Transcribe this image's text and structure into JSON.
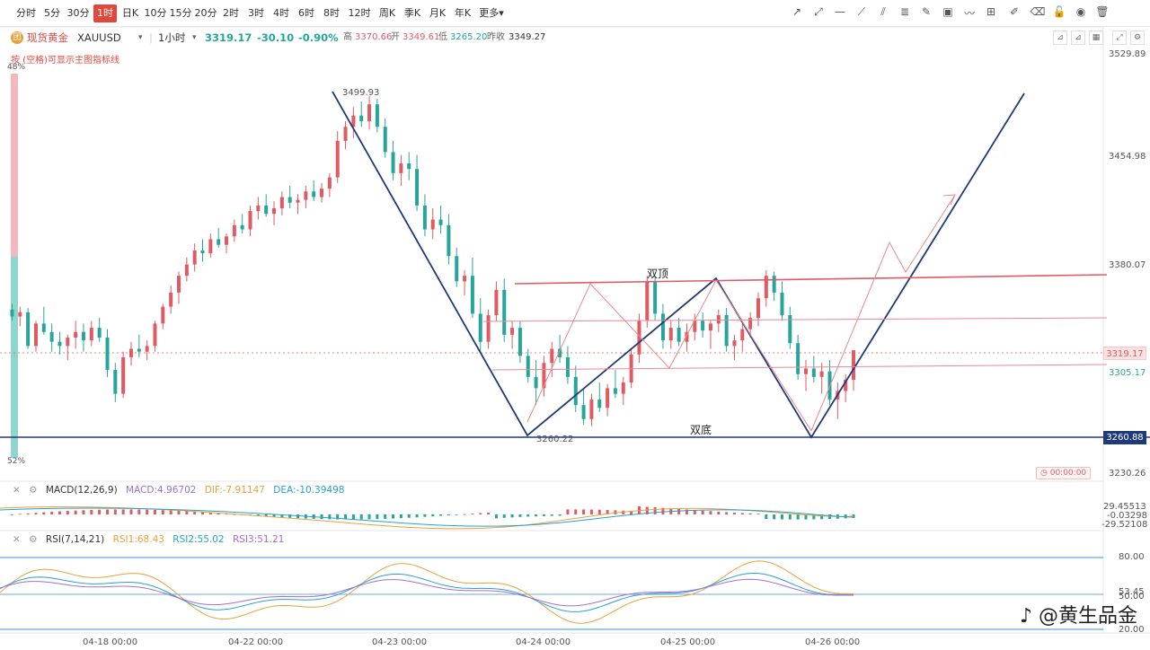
{
  "timeframes": [
    "分时",
    "5分",
    "30分",
    "1时",
    "日K",
    "10分",
    "15分",
    "20分",
    "2时",
    "3时",
    "4时",
    "6时",
    "8时",
    "12时",
    "周K",
    "季K",
    "月K",
    "年K",
    "更多"
  ],
  "active_timeframe": "1时",
  "symbol": {
    "logo_char": "团",
    "name": "现货黄金",
    "code": "XAUUSD",
    "period": "1小时",
    "price": "3319.17",
    "change": "-30.10",
    "change_pct": "-0.90%",
    "high_label": "高",
    "high": "3370.66",
    "open_label": "开",
    "open": "3349.61",
    "low_label": "低",
    "low": "3265.20",
    "prev_close_label": "昨收",
    "prev_close": "3349.27"
  },
  "hint": "按 (空格)可显示主图指标线",
  "pct_top": "48%",
  "pct_bottom": "52%",
  "price_axis": [
    "3529.89",
    "3454.98",
    "3380.07",
    "3305.17",
    "3230.26"
  ],
  "current_price_tag": "3319.17",
  "support_price_tag": "3260.88",
  "countdown": "00:00:00",
  "annotations": {
    "peak_value": "3499.93",
    "trough_value": "3260.22",
    "double_top": "双顶",
    "double_bottom": "双底"
  },
  "macd": {
    "title": "MACD(12,26,9)",
    "macd": "MACD:4.96702",
    "dif": "DIF:-7.91147",
    "dea": "DEA:-10.39498",
    "axis": [
      "29.45513",
      "-0.03298",
      "-29.52108"
    ]
  },
  "rsi": {
    "title": "RSI(7,14,21)",
    "rsi1": "RSI1:68.43",
    "rsi2": "RSI2:55.02",
    "rsi3": "RSI3:51.21",
    "axis": [
      "80.00",
      "53.45",
      "50.00",
      "20.00"
    ]
  },
  "time_axis": [
    "04-18 00:00",
    "04-22 00:00",
    "04-23 00:00",
    "04-24 00:00",
    "04-25 00:00",
    "04-26 00:00"
  ],
  "watermark": "@黄生品金",
  "colors": {
    "up": "#e05a63",
    "down": "#26a69a",
    "accent": "#e0483e",
    "trend": "#1f3a7a"
  },
  "chart_data": {
    "type": "candlestick",
    "symbol": "XAUUSD",
    "interval": "1h",
    "ylim": [
      3230.26,
      3529.89
    ],
    "candles_ohlc": [
      [
        3348,
        3352,
        3340,
        3343
      ],
      [
        3343,
        3350,
        3336,
        3346
      ],
      [
        3346,
        3349,
        3320,
        3322
      ],
      [
        3322,
        3340,
        3318,
        3338
      ],
      [
        3338,
        3350,
        3330,
        3332
      ],
      [
        3332,
        3338,
        3318,
        3325
      ],
      [
        3325,
        3332,
        3316,
        3322
      ],
      [
        3322,
        3330,
        3312,
        3328
      ],
      [
        3328,
        3340,
        3320,
        3332
      ],
      [
        3332,
        3338,
        3318,
        3326
      ],
      [
        3326,
        3340,
        3322,
        3335
      ],
      [
        3335,
        3342,
        3325,
        3328
      ],
      [
        3328,
        3334,
        3300,
        3305
      ],
      [
        3305,
        3310,
        3282,
        3288
      ],
      [
        3288,
        3318,
        3285,
        3314
      ],
      [
        3314,
        3325,
        3308,
        3320
      ],
      [
        3320,
        3330,
        3314,
        3318
      ],
      [
        3318,
        3326,
        3312,
        3322
      ],
      [
        3322,
        3340,
        3318,
        3338
      ],
      [
        3338,
        3352,
        3334,
        3350
      ],
      [
        3350,
        3365,
        3345,
        3360
      ],
      [
        3360,
        3375,
        3352,
        3372
      ],
      [
        3372,
        3385,
        3368,
        3380
      ],
      [
        3380,
        3395,
        3375,
        3390
      ],
      [
        3390,
        3398,
        3382,
        3388
      ],
      [
        3388,
        3402,
        3385,
        3398
      ],
      [
        3398,
        3406,
        3392,
        3394
      ],
      [
        3394,
        3402,
        3388,
        3400
      ],
      [
        3400,
        3412,
        3396,
        3408
      ],
      [
        3408,
        3416,
        3402,
        3405
      ],
      [
        3405,
        3422,
        3400,
        3418
      ],
      [
        3418,
        3428,
        3412,
        3422
      ],
      [
        3422,
        3430,
        3414,
        3416
      ],
      [
        3416,
        3425,
        3408,
        3420
      ],
      [
        3420,
        3432,
        3415,
        3428
      ],
      [
        3428,
        3436,
        3420,
        3424
      ],
      [
        3424,
        3430,
        3416,
        3426
      ],
      [
        3426,
        3436,
        3420,
        3432
      ],
      [
        3432,
        3440,
        3425,
        3428
      ],
      [
        3428,
        3438,
        3424,
        3434
      ],
      [
        3434,
        3445,
        3428,
        3442
      ],
      [
        3442,
        3475,
        3438,
        3468
      ],
      [
        3468,
        3482,
        3462,
        3478
      ],
      [
        3478,
        3492,
        3470,
        3486
      ],
      [
        3486,
        3496,
        3478,
        3482
      ],
      [
        3482,
        3500,
        3476,
        3494
      ],
      [
        3494,
        3498,
        3474,
        3478
      ],
      [
        3478,
        3484,
        3456,
        3460
      ],
      [
        3460,
        3468,
        3440,
        3445
      ],
      [
        3445,
        3458,
        3436,
        3452
      ],
      [
        3452,
        3460,
        3440,
        3448
      ],
      [
        3448,
        3458,
        3418,
        3422
      ],
      [
        3422,
        3430,
        3400,
        3405
      ],
      [
        3405,
        3420,
        3398,
        3412
      ],
      [
        3412,
        3422,
        3402,
        3408
      ],
      [
        3408,
        3416,
        3380,
        3386
      ],
      [
        3386,
        3392,
        3364,
        3368
      ],
      [
        3368,
        3376,
        3358,
        3372
      ],
      [
        3372,
        3385,
        3342,
        3345
      ],
      [
        3345,
        3356,
        3318,
        3325
      ],
      [
        3325,
        3348,
        3320,
        3344
      ],
      [
        3344,
        3368,
        3340,
        3362
      ],
      [
        3362,
        3370,
        3325,
        3330
      ],
      [
        3330,
        3340,
        3320,
        3335
      ],
      [
        3335,
        3340,
        3310,
        3315
      ],
      [
        3315,
        3320,
        3296,
        3300
      ],
      [
        3300,
        3312,
        3280,
        3292
      ],
      [
        3292,
        3315,
        3286,
        3310
      ],
      [
        3310,
        3325,
        3300,
        3320
      ],
      [
        3320,
        3330,
        3310,
        3314
      ],
      [
        3314,
        3322,
        3295,
        3300
      ],
      [
        3300,
        3308,
        3275,
        3280
      ],
      [
        3280,
        3292,
        3266,
        3270
      ],
      [
        3270,
        3288,
        3265,
        3284
      ],
      [
        3284,
        3296,
        3275,
        3278
      ],
      [
        3278,
        3295,
        3272,
        3292
      ],
      [
        3292,
        3305,
        3285,
        3288
      ],
      [
        3288,
        3300,
        3280,
        3296
      ],
      [
        3296,
        3320,
        3292,
        3316
      ],
      [
        3316,
        3345,
        3310,
        3340
      ],
      [
        3340,
        3372,
        3335,
        3368
      ],
      [
        3368,
        3372,
        3340,
        3345
      ],
      [
        3345,
        3352,
        3320,
        3326
      ],
      [
        3326,
        3340,
        3320,
        3335
      ],
      [
        3335,
        3342,
        3322,
        3325
      ],
      [
        3325,
        3338,
        3318,
        3332
      ],
      [
        3332,
        3345,
        3326,
        3340
      ],
      [
        3340,
        3346,
        3328,
        3333
      ],
      [
        3333,
        3340,
        3320,
        3338
      ],
      [
        3338,
        3348,
        3332,
        3344
      ],
      [
        3344,
        3349,
        3318,
        3322
      ],
      [
        3322,
        3330,
        3312,
        3326
      ],
      [
        3326,
        3338,
        3318,
        3334
      ],
      [
        3334,
        3346,
        3328,
        3342
      ],
      [
        3342,
        3360,
        3336,
        3356
      ],
      [
        3356,
        3376,
        3350,
        3372
      ],
      [
        3372,
        3375,
        3354,
        3360
      ],
      [
        3360,
        3368,
        3340,
        3344
      ],
      [
        3344,
        3350,
        3320,
        3324
      ],
      [
        3324,
        3330,
        3298,
        3302
      ],
      [
        3302,
        3312,
        3290,
        3306
      ],
      [
        3306,
        3315,
        3296,
        3300
      ],
      [
        3300,
        3310,
        3288,
        3304
      ],
      [
        3304,
        3312,
        3280,
        3284
      ],
      [
        3284,
        3296,
        3270,
        3290
      ],
      [
        3290,
        3302,
        3282,
        3298
      ],
      [
        3298,
        3318,
        3290,
        3319
      ]
    ],
    "annotations": [
      {
        "label": "3499.93",
        "type": "peak"
      },
      {
        "label": "3260.22",
        "type": "trough"
      },
      {
        "label": "双顶",
        "type": "pattern"
      },
      {
        "label": "双底",
        "type": "pattern"
      }
    ]
  }
}
